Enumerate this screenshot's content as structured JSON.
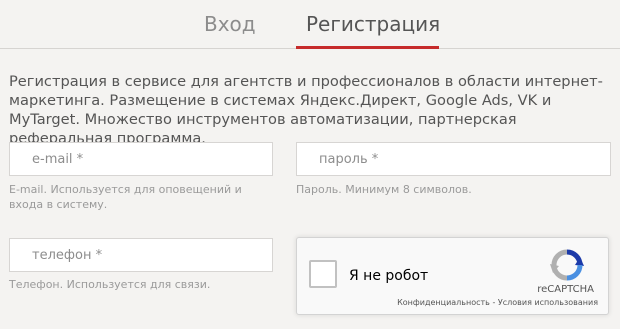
{
  "tabs": {
    "login": "Вход",
    "register": "Регистрация",
    "active": "register",
    "accent_color": "#c62b2b"
  },
  "intro": "Регистрация в сервисе для агентств и профессионалов в области интернет-маркетинга. Размещение в системах Яндекс.Директ, Google Ads, VK и MyTarget. Множество инструментов автоматизации, партнерская реферальная программа.",
  "form": {
    "email": {
      "placeholder": "e-mail *",
      "value": "",
      "hint": "E-mail. Используется для оповещений и входа в систему."
    },
    "password": {
      "placeholder": "пароль *",
      "value": "",
      "hint": "Пароль. Минимум 8 символов."
    },
    "phone": {
      "placeholder": "телефон *",
      "value": "",
      "hint": "Телефон. Используется для связи."
    }
  },
  "recaptcha": {
    "label": "Я не робот",
    "brand": "reCAPTCHA",
    "privacy": "Конфиденциальность",
    "separator": " - ",
    "terms": "Условия использования",
    "checked": false,
    "logo_icon": "recaptcha-logo-icon"
  }
}
